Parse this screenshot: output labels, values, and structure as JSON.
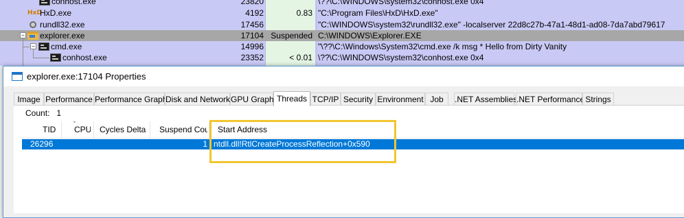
{
  "process_list": {
    "rows": [
      {
        "name": "conhost.exe",
        "pid": "23820",
        "cpu": "",
        "command": "\\??\\C:\\WINDOWS\\system32\\conhost.exe 0x4",
        "icon": "console-icon"
      },
      {
        "name": "HxD.exe",
        "pid": "4192",
        "cpu": "0.83",
        "command": "\"C:\\Program Files\\HxD\\HxD.exe\"",
        "icon": "hxd-icon"
      },
      {
        "name": "rundll32.exe",
        "pid": "17456",
        "cpu": "",
        "command": "\"C:\\WINDOWS\\system32\\rundll32.exe\" -localserver 22d8c27b-47a1-48d1-ad08-7da7abd79617",
        "icon": "gear-icon"
      },
      {
        "name": "explorer.exe",
        "pid": "17104",
        "cpu": "Suspended",
        "command": "C:\\WINDOWS\\Explorer.EXE",
        "icon": "folder-icon"
      },
      {
        "name": "cmd.exe",
        "pid": "14996",
        "cpu": "",
        "command": "\"\\??\\C:\\Windows\\System32\\cmd.exe /k msg * Hello from Dirty Vanity",
        "icon": "console-icon"
      },
      {
        "name": "conhost.exe",
        "pid": "23352",
        "cpu": "< 0.01",
        "command": "\\??\\C:\\WINDOWS\\system32\\conhost.exe 0x4",
        "icon": "console-icon"
      }
    ]
  },
  "dialog": {
    "title": "explorer.exe:17104 Properties",
    "tabs": [
      {
        "label": "Image"
      },
      {
        "label": "Performance"
      },
      {
        "label": "Performance Graph"
      },
      {
        "label": "Disk and Network"
      },
      {
        "label": "GPU Graph"
      },
      {
        "label": "Threads"
      },
      {
        "label": "TCP/IP"
      },
      {
        "label": "Security"
      },
      {
        "label": "Environment"
      },
      {
        "label": "Job"
      },
      {
        "label": ".NET Assemblies"
      },
      {
        "label": ".NET Performance"
      },
      {
        "label": "Strings"
      }
    ],
    "active_tab": "Threads",
    "count_label": "Count:",
    "count_value": "1",
    "columns": [
      "TID",
      "CPU",
      "Cycles Delta",
      "Suspend Count",
      "Start Address"
    ],
    "threads": [
      {
        "tid": "26296",
        "cpu": "",
        "cycles_delta": "",
        "suspend_count": "1",
        "start_address": "ntdll.dll!RtlCreateProcessReflection+0x590"
      }
    ]
  },
  "colors": {
    "process_row_bg": "#c9c9f5",
    "suspended_row_bg": "#a7a7a7",
    "selection_blue": "#0078d7",
    "highlight_box": "#f2c530"
  }
}
